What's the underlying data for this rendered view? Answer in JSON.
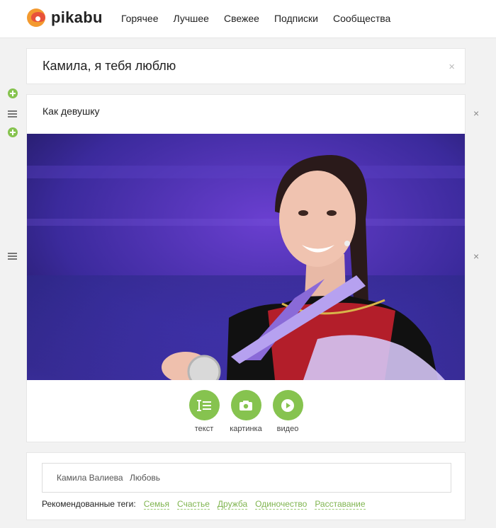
{
  "header": {
    "logo_text": "pikabu",
    "nav": [
      {
        "label": "Горячее"
      },
      {
        "label": "Лучшее"
      },
      {
        "label": "Свежее"
      },
      {
        "label": "Подписки"
      },
      {
        "label": "Сообщества"
      }
    ]
  },
  "post": {
    "title": "Камила, я тебя люблю",
    "title_close": "×",
    "text_block": "Как девушку",
    "block_close": "×",
    "image_close": "×"
  },
  "add_block": {
    "items": [
      {
        "label": "текст",
        "icon": "text-icon"
      },
      {
        "label": "картинка",
        "icon": "camera-icon"
      },
      {
        "label": "видео",
        "icon": "play-icon"
      }
    ]
  },
  "tags": {
    "entered": [
      "Камила Валиева",
      "Любовь"
    ],
    "recommended_label": "Рекомендованные теги:",
    "recommended": [
      "Семья",
      "Счастье",
      "Дружба",
      "Одиночество",
      "Расставание"
    ]
  },
  "colors": {
    "accent_green": "#86c34f",
    "logo_orange": "#f39a2f",
    "logo_red": "#e8523a"
  }
}
